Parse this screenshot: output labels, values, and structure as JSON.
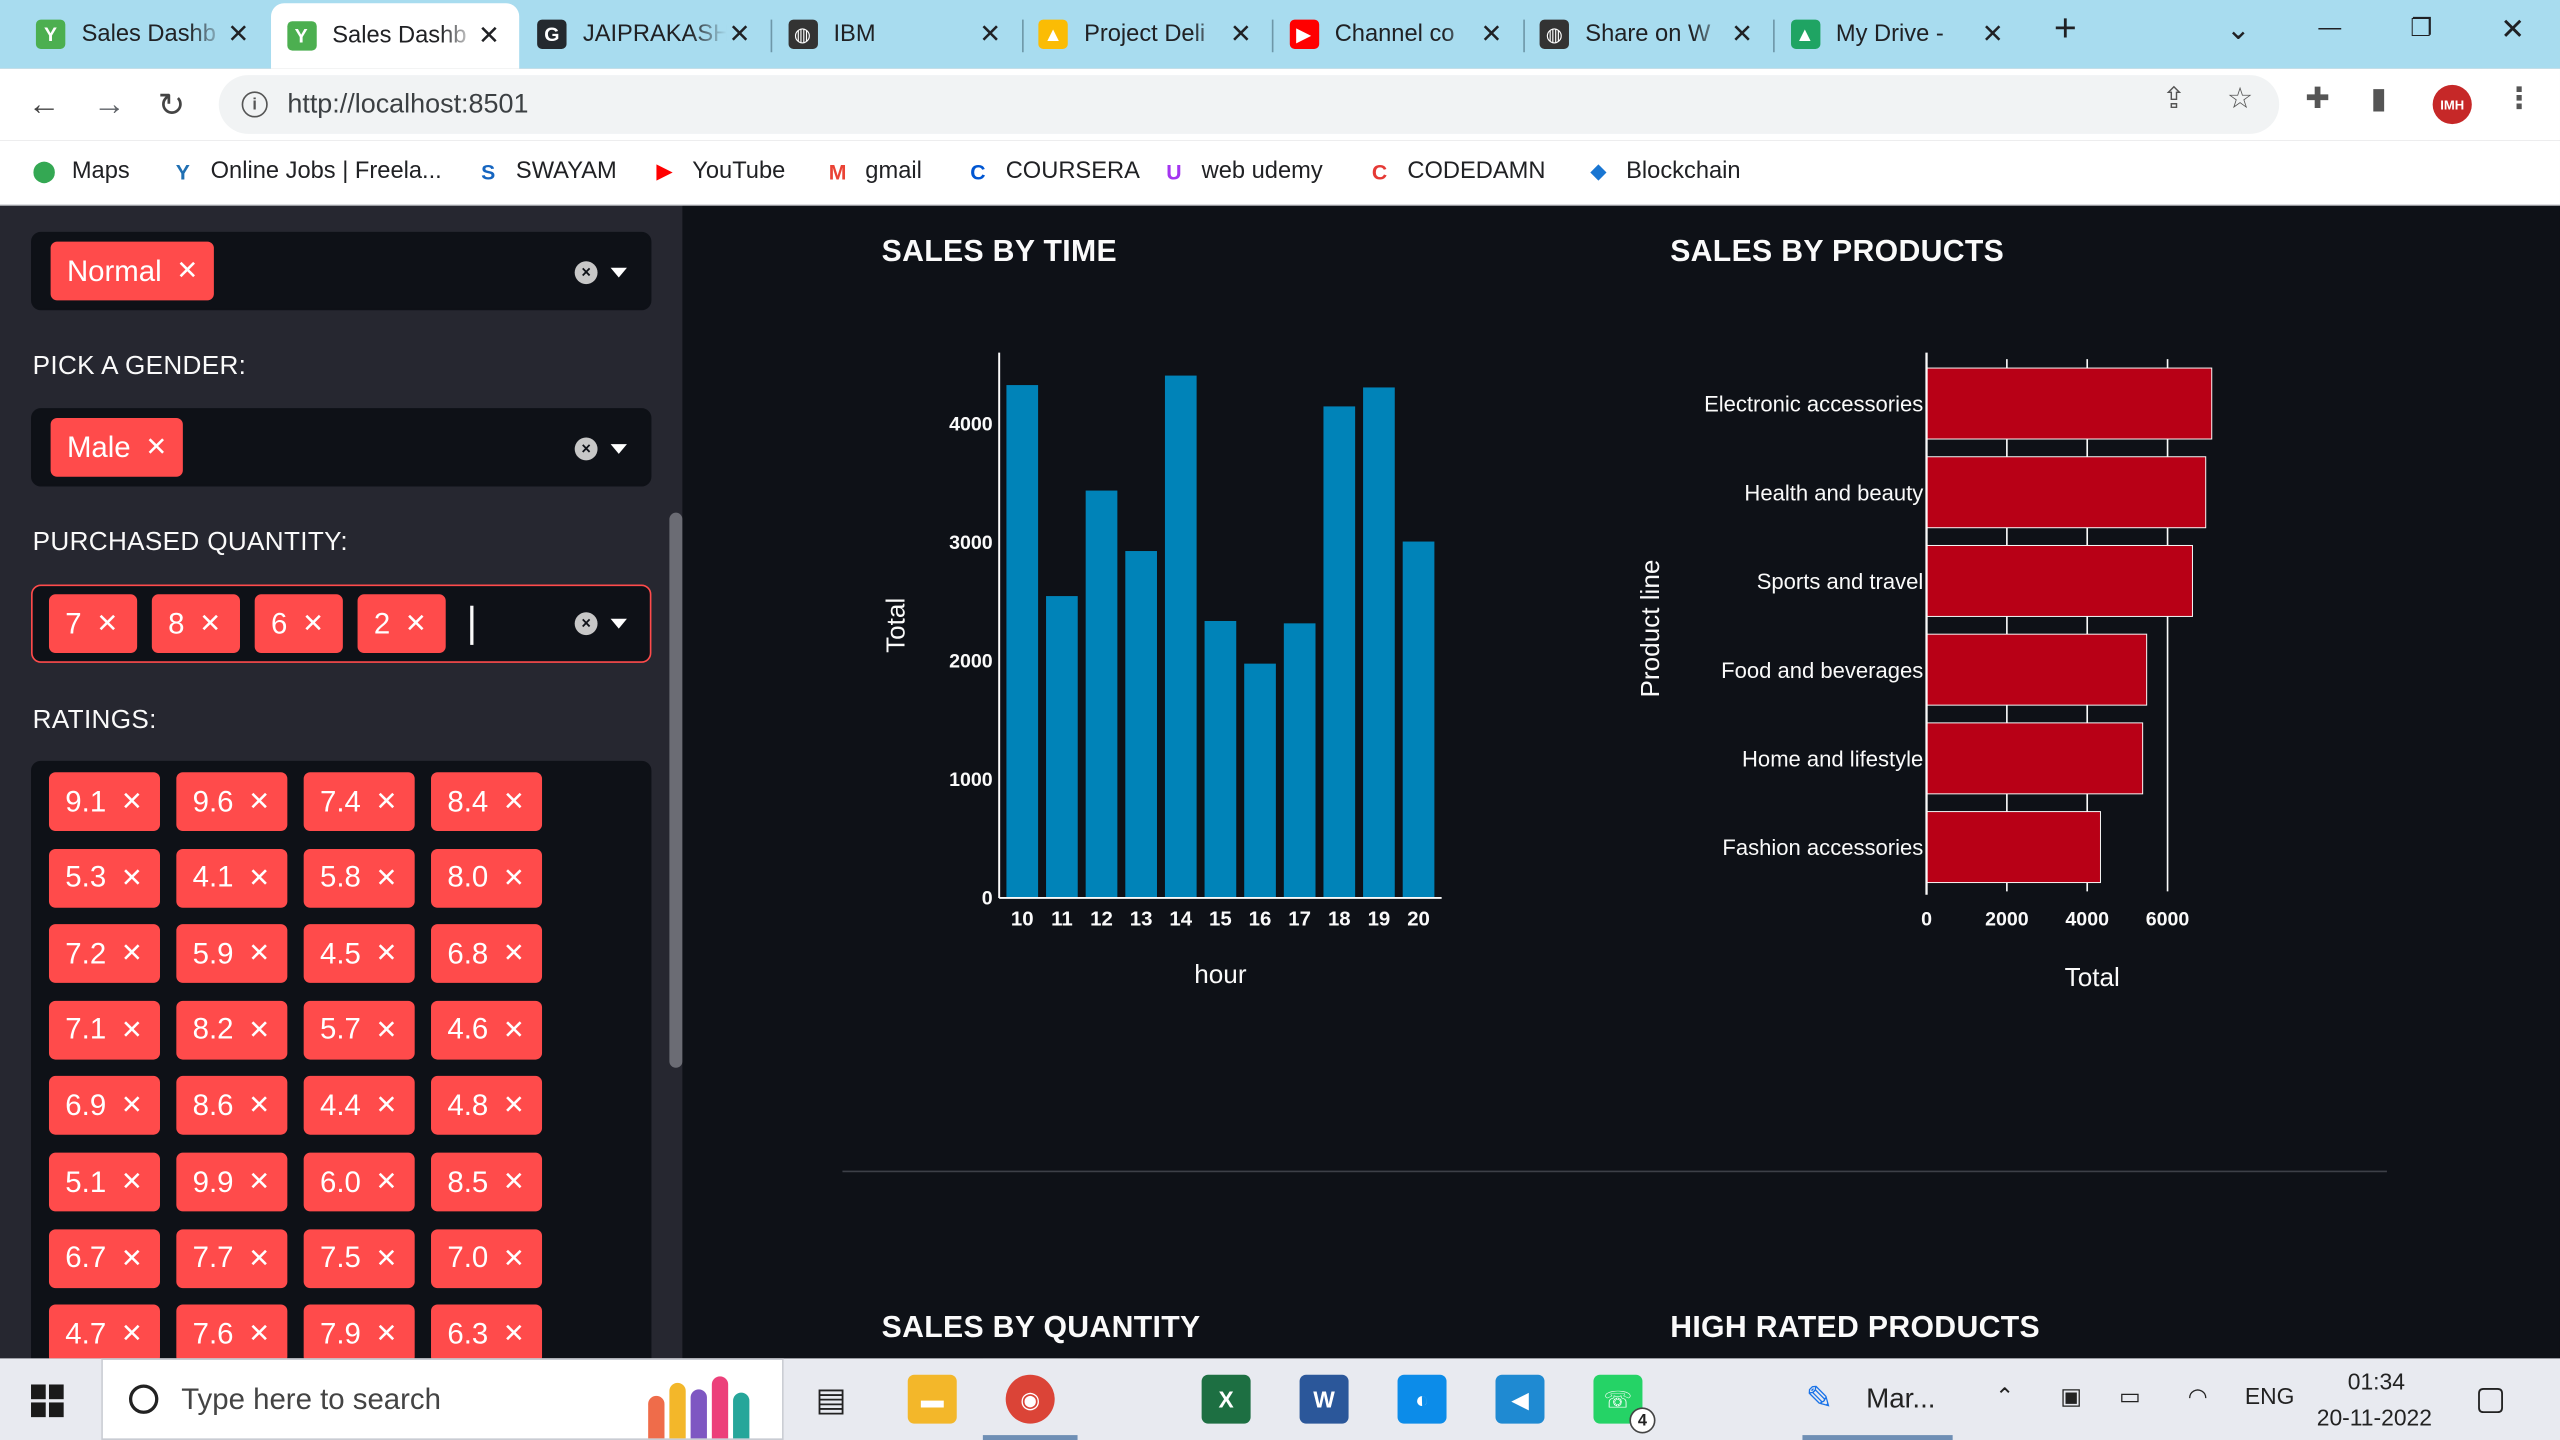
{
  "browser": {
    "tabs": [
      {
        "label": "Sales Dashb",
        "fav_color": "#4caf50",
        "fav": "Y"
      },
      {
        "label": "Sales Dashb",
        "fav_color": "#4caf50",
        "fav": "Y",
        "active": true
      },
      {
        "label": "JAIPRAKASH",
        "fav_color": "#24292e",
        "fav": "G"
      },
      {
        "label": "IBM",
        "fav_color": "#333333",
        "fav": "◍"
      },
      {
        "label": "Project Deli",
        "fav_color": "#fbbc04",
        "fav": "▲"
      },
      {
        "label": "Channel co",
        "fav_color": "#ff0000",
        "fav": "▶"
      },
      {
        "label": "Share on W",
        "fav_color": "#333333",
        "fav": "◍"
      },
      {
        "label": "My Drive -",
        "fav_color": "#1fa463",
        "fav": "▲"
      }
    ],
    "tab_close": "✕",
    "new_tab": "+",
    "url": "http://localhost:8501",
    "window_controls": {
      "caret": "⌄",
      "minimize": "—",
      "restore": "❐",
      "close": "✕"
    },
    "bookmarks": [
      {
        "label": "Maps",
        "icon": "map-pin-icon",
        "color": "#34a853"
      },
      {
        "label": "Online Jobs | Freela...",
        "icon": "freelancer-icon",
        "color": "#1f6fb2"
      },
      {
        "label": "SWAYAM",
        "icon": "swayam-icon",
        "color": "#1565c0"
      },
      {
        "label": "YouTube",
        "icon": "youtube-icon",
        "color": "#ff0000"
      },
      {
        "label": "gmail",
        "icon": "gmail-icon",
        "color": "#ea4335"
      },
      {
        "label": "COURSERA",
        "icon": "coursera-icon",
        "color": "#0056d2"
      },
      {
        "label": "web udemy",
        "icon": "udemy-icon",
        "color": "#a435f0"
      },
      {
        "label": "CODEDAMN",
        "icon": "codedamn-icon",
        "color": "#e53935"
      },
      {
        "label": "Blockchain",
        "icon": "blockchain-icon",
        "color": "#1976d2"
      }
    ],
    "profile_initials": "IMH"
  },
  "sidebar": {
    "customer_type_chips": [
      "Normal"
    ],
    "gender_label": "PICK A GENDER:",
    "gender_chips": [
      "Male"
    ],
    "quantity_label": "PURCHASED QUANTITY:",
    "quantity_chips": [
      "7",
      "8",
      "6",
      "2"
    ],
    "ratings_label": "RATINGS:",
    "rating_chips": [
      "9.1",
      "9.6",
      "7.4",
      "8.4",
      "5.3",
      "4.1",
      "5.8",
      "8.0",
      "7.2",
      "5.9",
      "4.5",
      "6.8",
      "7.1",
      "8.2",
      "5.7",
      "4.6",
      "6.9",
      "8.6",
      "4.4",
      "4.8",
      "5.1",
      "9.9",
      "6.0",
      "8.5",
      "6.7",
      "7.7",
      "7.5",
      "7.0",
      "4.7",
      "7.6",
      "7.9",
      "6.3"
    ],
    "chip_remove": "✕",
    "clear_glyph": "×"
  },
  "main": {
    "sales_by_time_title": "SALES BY TIME",
    "sales_by_products_title": "SALES BY PRODUCTS",
    "sales_by_quantity_title": "SALES BY QUANTITY",
    "high_rated_title": "HIGH RATED PRODUCTS"
  },
  "chart_data": [
    {
      "type": "bar",
      "orientation": "vertical",
      "categories": [
        "10",
        "11",
        "12",
        "13",
        "14",
        "15",
        "16",
        "17",
        "18",
        "19",
        "20"
      ],
      "values": [
        4330,
        2550,
        3440,
        2930,
        4410,
        2340,
        1980,
        2320,
        4150,
        4310,
        3010
      ],
      "xlabel": "hour",
      "ylabel": "Total",
      "ylim": [
        0,
        4600
      ],
      "yticks": [
        0,
        1000,
        2000,
        3000,
        4000
      ],
      "color": "#0083b8",
      "grid": false
    },
    {
      "type": "bar",
      "orientation": "horizontal",
      "categories": [
        "Electronic accessories",
        "Health and beauty",
        "Sports and travel",
        "Food and beverages",
        "Home and lifestyle",
        "Fashion accessories"
      ],
      "values": [
        7100,
        6950,
        6620,
        5480,
        5380,
        4330
      ],
      "xlabel": "Total",
      "ylabel": "Product line",
      "xlim": [
        0,
        7600
      ],
      "xticks": [
        0,
        2000,
        4000,
        6000
      ],
      "color": "#b80016",
      "grid": true
    }
  ],
  "taskbar": {
    "search_placeholder": "Type here to search",
    "pinned": [
      {
        "icon": "task-view-icon"
      },
      {
        "icon": "file-explorer-icon",
        "color": "#f3b72a"
      },
      {
        "icon": "chrome-icon",
        "color": "#db4437"
      },
      {
        "icon": "excel-icon",
        "color": "#1d6f42",
        "glyph": "X"
      },
      {
        "icon": "word-icon",
        "color": "#2b579a",
        "glyph": "W"
      },
      {
        "icon": "edge-icon",
        "color": "#0c8ce9"
      },
      {
        "icon": "vscode-icon",
        "color": "#1f8ad2"
      },
      {
        "icon": "whatsapp-icon",
        "color": "#25d366",
        "badge": "4"
      }
    ],
    "running_app_label": "Mar...",
    "language": "ENG",
    "time": "01:34",
    "date": "20-11-2022"
  }
}
